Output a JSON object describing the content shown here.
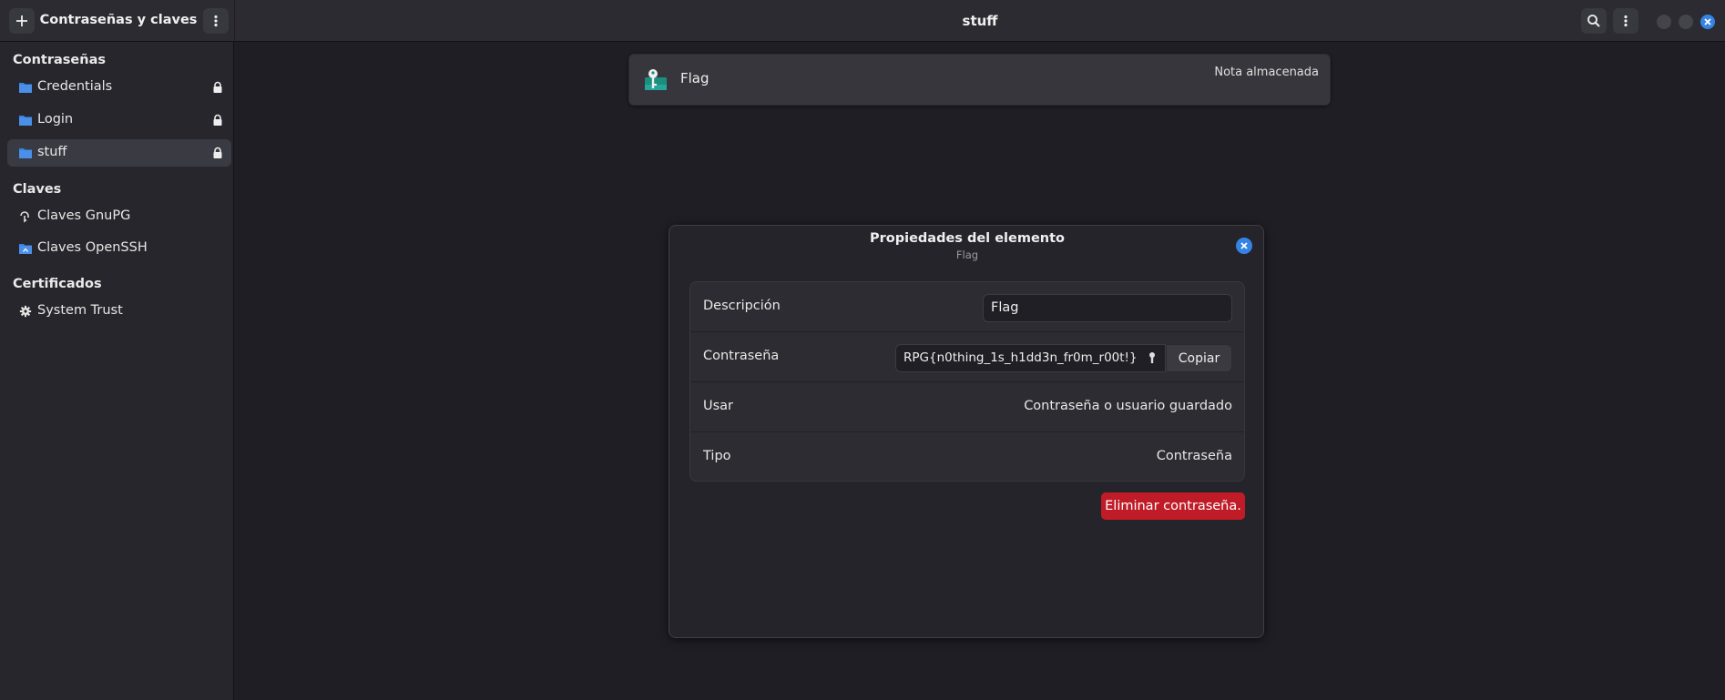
{
  "sidebar": {
    "title": "Contraseñas y claves",
    "new_button_icon": "plus-icon",
    "menu_button_icon": "kebab-menu-icon",
    "sections": {
      "passwords": "Contraseñas",
      "keys": "Claves",
      "certificates": "Certificados"
    },
    "password_items": [
      {
        "label": "Credentials",
        "icon": "folder-icon",
        "locked": true
      },
      {
        "label": "Login",
        "icon": "folder-icon",
        "locked": true
      },
      {
        "label": "stuff",
        "icon": "folder-icon",
        "locked": true,
        "selected": true
      }
    ],
    "key_items": [
      {
        "label": "Claves GnuPG",
        "icon": "gnupg-key-icon"
      },
      {
        "label": "Claves OpenSSH",
        "icon": "ssh-key-icon"
      }
    ],
    "certificate_items": [
      {
        "label": "System Trust",
        "icon": "gear-icon"
      }
    ]
  },
  "header": {
    "title": "stuff",
    "search_icon": "search-icon",
    "menu_icon": "kebab-menu-icon"
  },
  "list": {
    "items": [
      {
        "label": "Flag",
        "note": "Nota almacenada",
        "icon": "password-key-icon"
      }
    ]
  },
  "dialog": {
    "title": "Propiedades del elemento",
    "subtitle": "Flag",
    "rows": {
      "description": {
        "label": "Descripción",
        "value": "Flag"
      },
      "password": {
        "label": "Contraseña",
        "value": "RPG{n0thing_1s_h1dd3n_fr0m_r00t!}",
        "copy_label": "Copiar"
      },
      "use": {
        "label": "Usar",
        "value": "Contraseña o usuario guardado"
      },
      "type": {
        "label": "Tipo",
        "value": "Contraseña"
      }
    },
    "delete_label": "Eliminar contraseña."
  },
  "colors": {
    "accent": "#3584e4",
    "destructive": "#c01c28",
    "folder": "#3584e4"
  }
}
